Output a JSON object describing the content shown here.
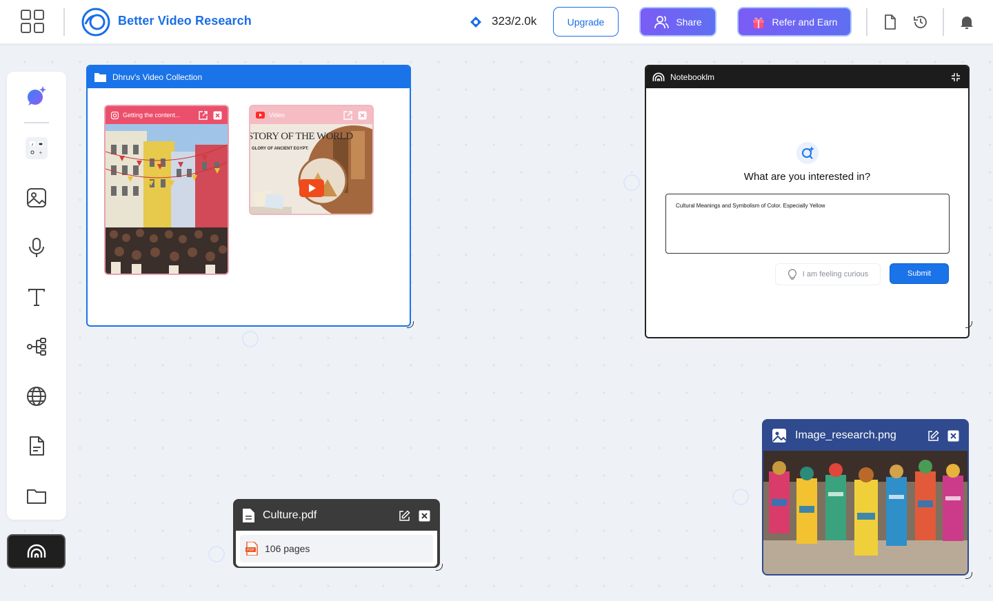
{
  "header": {
    "brand": "Better Video Research",
    "credits": "323/2.0k",
    "upgrade_label": "Upgrade",
    "share_label": "Share",
    "refer_label": "Refer and Earn"
  },
  "icons": {
    "apps": "apps-grid-icon",
    "logo": "brand-logo-icon",
    "credits": "credits-diamond-icon",
    "share": "users-icon",
    "refer": "gift-icon",
    "document": "document-icon",
    "history": "history-icon",
    "notifications": "bell-icon"
  },
  "toolbar": {
    "items": [
      "ai-assistant",
      "social-apps",
      "image",
      "microphone",
      "text",
      "mind-map",
      "web",
      "document",
      "folder",
      "notebooklm"
    ]
  },
  "folder_card": {
    "title": "Dhruv's Video Collection",
    "items": [
      {
        "label": "Getting the content...",
        "source": "instagram"
      },
      {
        "label": "Video",
        "source": "youtube",
        "thumb_title": "STORY OF THE WORLD",
        "thumb_subtitle": "GLORY OF ANCIENT EGYPT:"
      }
    ]
  },
  "notebook_card": {
    "title": "Notebooklm",
    "question": "What are you interested in?",
    "input_value": "Cultural Meanings and Symbolism of Color. Especially Yellow",
    "curious_label": "I am feeling curious",
    "submit_label": "Submit"
  },
  "pdf_card": {
    "title": "Culture.pdf",
    "pages": "106 pages",
    "badge": "PDF"
  },
  "image_card": {
    "title": "Image_research.png"
  },
  "colors": {
    "accent": "#1a73e8",
    "brand": "#1a6ee8",
    "gradient_start": "#7b5cf5",
    "gradient_end": "#5f6ff2",
    "canvas": "#eef2f7",
    "dark_card": "#1c1c1c",
    "pdf_card": "#3b3b3b",
    "image_card": "#2f4a8e"
  }
}
